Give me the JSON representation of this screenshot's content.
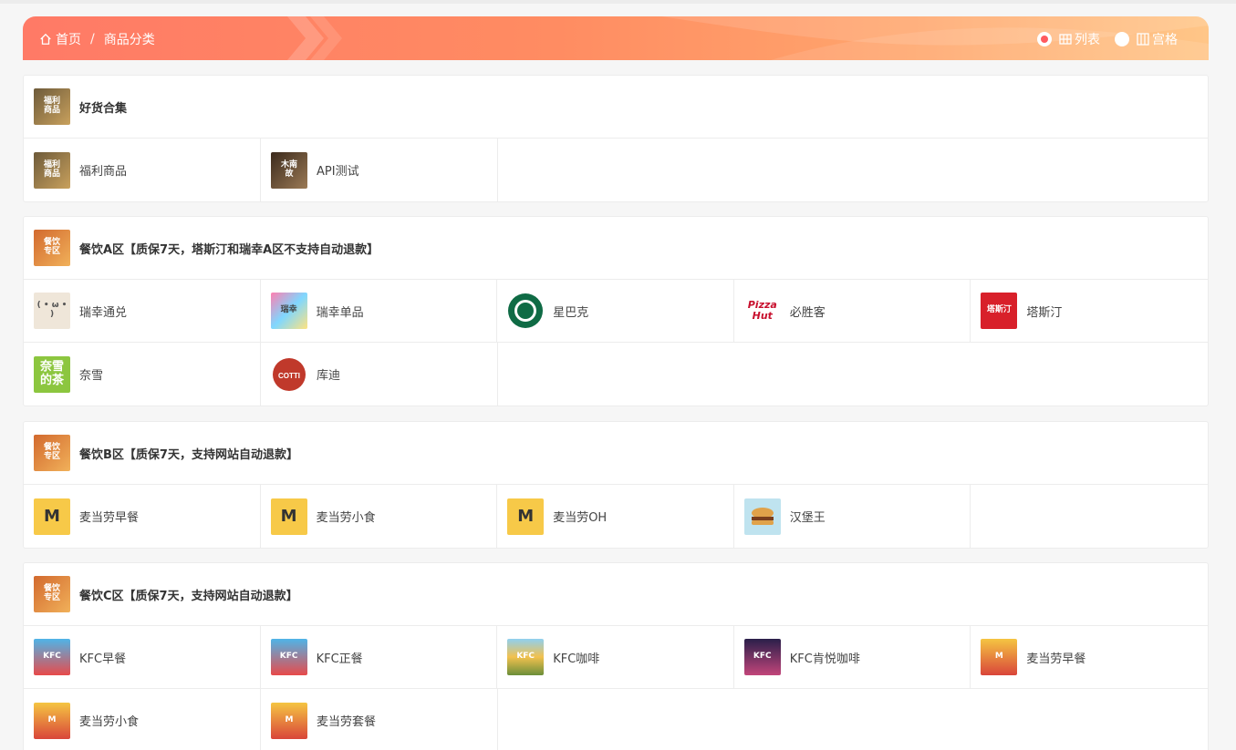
{
  "breadcrumb": {
    "home": "首页",
    "separator": "/",
    "current": "商品分类"
  },
  "view_toggle": {
    "list_label": "列表",
    "grid_label": "宫格",
    "selected": "list"
  },
  "categories": [
    {
      "title": "好货合集",
      "icon": "welfare-thumb",
      "items": [
        {
          "label": "福利商品",
          "icon": "welfare-thumb"
        },
        {
          "label": "API测试",
          "icon": "api-test-thumb"
        }
      ]
    },
    {
      "title": "餐饮A区【质保7天，塔斯汀和瑞幸A区不支持自动退款】",
      "icon": "catering-thumb",
      "items": [
        {
          "label": "瑞幸通兑",
          "icon": "luckin-thumb"
        },
        {
          "label": "瑞幸单品",
          "icon": "luckin-single-thumb"
        },
        {
          "label": "星巴克",
          "icon": "starbucks-logo"
        },
        {
          "label": "必胜客",
          "icon": "pizzahut-logo"
        },
        {
          "label": "塔斯汀",
          "icon": "tastien-logo"
        },
        {
          "label": "奈雪",
          "icon": "nayuki-logo"
        },
        {
          "label": "库迪",
          "icon": "cotti-logo"
        }
      ]
    },
    {
      "title": "餐饮B区【质保7天，支持网站自动退款】",
      "icon": "catering-thumb",
      "items": [
        {
          "label": "麦当劳早餐",
          "icon": "mcdonalds-thumb"
        },
        {
          "label": "麦当劳小食",
          "icon": "mcdonalds-thumb"
        },
        {
          "label": "麦当劳OH",
          "icon": "mcdonalds-thumb"
        },
        {
          "label": "汉堡王",
          "icon": "burgerking-thumb"
        }
      ]
    },
    {
      "title": "餐饮C区【质保7天，支持网站自动退款】",
      "icon": "catering-thumb",
      "items": [
        {
          "label": "KFC早餐",
          "icon": "kfc-thumb"
        },
        {
          "label": "KFC正餐",
          "icon": "kfc-thumb"
        },
        {
          "label": "KFC咖啡",
          "icon": "kfc-coffee-thumb"
        },
        {
          "label": "KFC肯悦咖啡",
          "icon": "kfc-kenyue-thumb"
        },
        {
          "label": "麦当劳早餐",
          "icon": "mcd-poster-thumb"
        },
        {
          "label": "麦当劳小食",
          "icon": "mcd-poster-thumb"
        },
        {
          "label": "麦当劳套餐",
          "icon": "mcd-poster-thumb"
        }
      ]
    }
  ],
  "colors": {
    "accent": "#ff5a5f",
    "banner_start": "#ff7a66",
    "banner_end": "#ffc688"
  }
}
